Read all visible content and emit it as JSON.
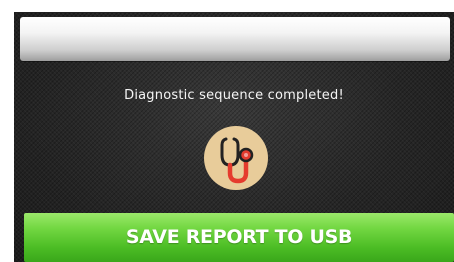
{
  "status": {
    "message": "Diagnostic sequence completed!"
  },
  "icon": {
    "name": "stethoscope-icon",
    "badge_color": "#e8cc9a",
    "tube_color": "#e53b2e"
  },
  "actions": {
    "save_label": "SAVE REPORT TO USB",
    "save_color": "#5cc832"
  }
}
